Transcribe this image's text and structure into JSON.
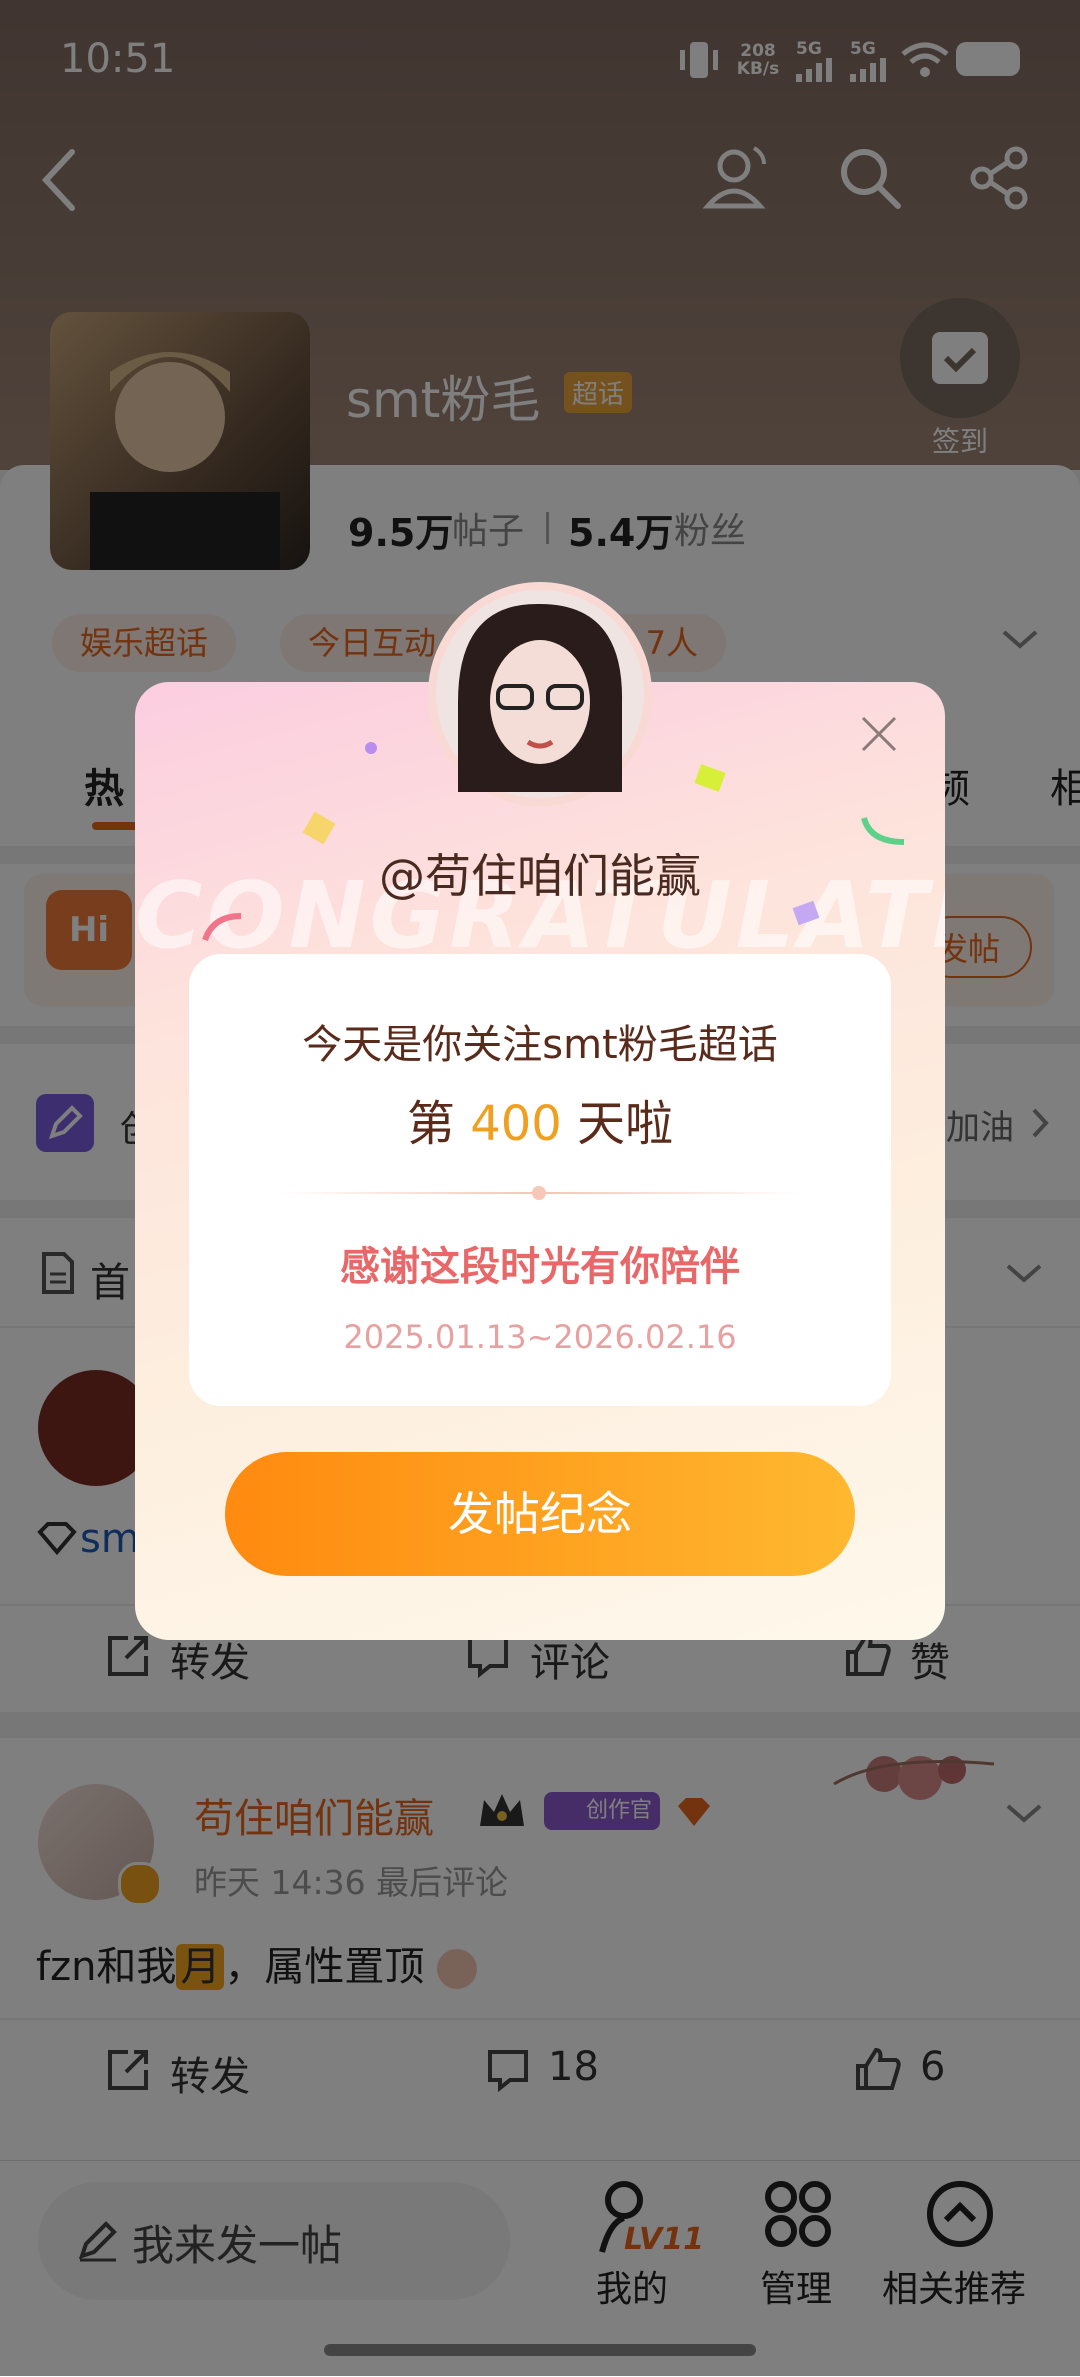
{
  "status_bar": {
    "time": "10:51",
    "net_speed_value": "208",
    "net_speed_unit": "KB/s",
    "sim1": "5G",
    "sim2": "5G"
  },
  "header": {
    "title": "smt粉毛",
    "badge": "超话",
    "checkin_label": "签到"
  },
  "stats": {
    "posts_value": "9.5万",
    "posts_label": "帖子",
    "fans_value": "5.4万",
    "fans_label": "粉丝"
  },
  "chips": {
    "category": "娱乐超话",
    "today": "今日互动",
    "today_count": "7人"
  },
  "tabs": {
    "first": "热",
    "right1": "频",
    "right2": "相"
  },
  "banner": {
    "hi": "Hi",
    "post_btn": "发帖"
  },
  "row_cheer": {
    "left": "创",
    "right": "加油"
  },
  "section": {
    "label": "首"
  },
  "post1": {
    "text_fragment": "sm",
    "repost": "转发",
    "comment": "评论",
    "like": "赞"
  },
  "post2": {
    "username": "苟住咱们能赢",
    "creator_tag": "创作官",
    "time": "昨天 14:36",
    "meta": "最后评论",
    "text": "fzn和我",
    "moon": "月",
    "text_tail": "，属性置顶",
    "repost": "转发",
    "comments": "18",
    "likes": "6"
  },
  "bottom_bar": {
    "composer": "我来发一帖",
    "mine_level": "LV11",
    "mine": "我的",
    "manage": "管理",
    "related": "相关推荐"
  },
  "dialog": {
    "username": "@苟住咱们能赢",
    "bg_word": "CONGRATULATE",
    "line1": "今天是你关注smt粉毛超话",
    "day_prefix": "第",
    "day_number": "400",
    "day_suffix": "天啦",
    "thanks": "感谢这段时光有你陪伴",
    "date_range": "2025.01.13~2026.02.16",
    "cta": "发帖纪念"
  },
  "colors": {
    "accent_orange": "#e8671f",
    "cta_start": "#ff8a10",
    "cta_end": "#ffb830",
    "day_number": "#f0a020",
    "thanks_text": "#e8686a"
  }
}
